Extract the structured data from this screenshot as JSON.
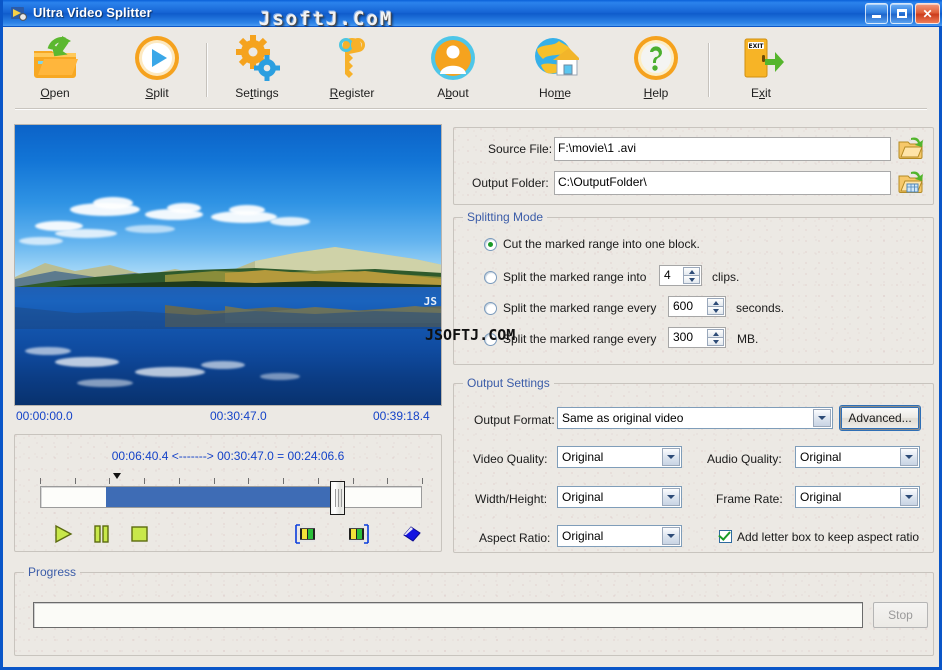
{
  "window": {
    "title": "Ultra Video Splitter",
    "app_icon": "splitter-icon",
    "minimize_label": "Minimize",
    "maximize_label": "Maximize",
    "close_label": "Close"
  },
  "watermarks": {
    "title_bar": "JsoftJ.CoM",
    "body": "JSOFTJ.COM",
    "preview": "JS"
  },
  "toolbar": {
    "items": [
      {
        "name": "open",
        "label_pre": "",
        "label_key": "O",
        "label_post": "pen",
        "icon": "open-folder-icon"
      },
      {
        "name": "split",
        "label_pre": "",
        "label_key": "S",
        "label_post": "plit",
        "icon": "play-split-icon"
      },
      {
        "name": "settings",
        "label_pre": "Se",
        "label_key": "t",
        "label_post": "tings",
        "icon": "gears-icon"
      },
      {
        "name": "register",
        "label_pre": "",
        "label_key": "R",
        "label_post": "egister",
        "icon": "key-icon"
      },
      {
        "name": "about",
        "label_pre": "A",
        "label_key": "b",
        "label_post": "out",
        "icon": "user-icon"
      },
      {
        "name": "home",
        "label_pre": "Ho",
        "label_key": "m",
        "label_post": "e",
        "icon": "globe-house-icon"
      },
      {
        "name": "help",
        "label_pre": "",
        "label_key": "H",
        "label_post": "elp",
        "icon": "question-icon"
      },
      {
        "name": "exit",
        "label_pre": "E",
        "label_key": "x",
        "label_post": "it",
        "icon": "exit-door-icon"
      }
    ],
    "exit_icon_text": "EXIT"
  },
  "files": {
    "source_label": "Source File:",
    "source_value": "F:\\movie\\1 .avi",
    "output_label": "Output Folder:",
    "output_value": "C:\\OutputFolder\\",
    "browse_source_icon": "open-folder-browse-icon",
    "browse_output_icon": "open-folder-output-icon"
  },
  "splitting_mode": {
    "legend": "Splitting Mode",
    "options": [
      {
        "name": "cut-one-block",
        "selected": true,
        "text_before": "Cut the marked range into one block.",
        "value": null,
        "text_after": ""
      },
      {
        "name": "split-into-clips",
        "selected": false,
        "text_before": "Split the marked range into",
        "value": "4",
        "text_after": "clips."
      },
      {
        "name": "split-every-secs",
        "selected": false,
        "text_before": "Split the marked range every",
        "value": "600",
        "text_after": "seconds."
      },
      {
        "name": "split-every-mb",
        "selected": false,
        "text_before": "Split the marked range every",
        "value": "300",
        "text_after": "MB."
      }
    ]
  },
  "output_settings": {
    "legend": "Output Settings",
    "format_label": "Output Format:",
    "format_value": "Same as original video",
    "advanced_label": "Advanced...",
    "video_quality_label": "Video Quality:",
    "video_quality_value": "Original",
    "audio_quality_label": "Audio Quality:",
    "audio_quality_value": "Original",
    "width_height_label": "Width/Height:",
    "width_height_value": "Original",
    "frame_rate_label": "Frame Rate:",
    "frame_rate_value": "Original",
    "aspect_ratio_label": "Aspect Ratio:",
    "aspect_ratio_value": "Original",
    "letterbox_label": "Add letter box to keep aspect ratio",
    "letterbox_checked": true
  },
  "player": {
    "time_start": "00:00:00.0",
    "time_current": "00:30:47.0",
    "time_total": "00:39:18.4",
    "range_text": "00:06:40.4 <-------> 00:30:47.0 = 00:24:06.6",
    "mark_in_pct": 17,
    "mark_out_pct": 78,
    "thumb_pct": 78,
    "controls": [
      {
        "name": "play-button",
        "icon": "play-icon"
      },
      {
        "name": "pause-button",
        "icon": "pause-icon"
      },
      {
        "name": "stop-button",
        "icon": "stop-icon"
      },
      {
        "name": "mark-start-button",
        "icon": "mark-start-filmstrip-icon"
      },
      {
        "name": "mark-end-button",
        "icon": "mark-end-filmstrip-icon"
      },
      {
        "name": "reset-marks-button",
        "icon": "blue-diamond-icon"
      }
    ]
  },
  "progress": {
    "legend": "Progress",
    "value_pct": 0,
    "stop_label": "Stop",
    "stop_enabled": false
  },
  "colors": {
    "title_blue": "#1664d4",
    "group_label_blue": "#3b5ca8",
    "timecode_blue": "#1543c8",
    "track_fill_blue": "#3e6cb5",
    "window_bg": "#ece9e4",
    "border_blue": "#0a56c8"
  }
}
